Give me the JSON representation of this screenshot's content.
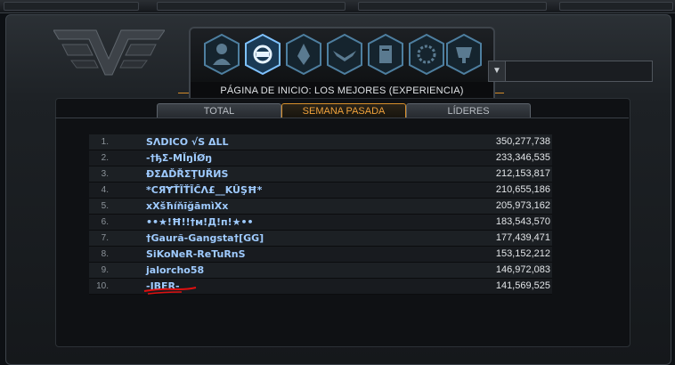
{
  "header": {
    "title": "PÁGINA DE INICIO: LOS MEJORES (EXPERIENCIA)"
  },
  "nav_icons": [
    "profile-icon",
    "emblem-icon",
    "rank-icon",
    "wings-icon",
    "codex-icon",
    "circle-icon",
    "trophy-icon"
  ],
  "tabs": [
    {
      "label": "TOTAL",
      "active": false
    },
    {
      "label": "SEMANA PASADA",
      "active": true
    },
    {
      "label": "LÍDERES",
      "active": false
    }
  ],
  "leaderboard": [
    {
      "rank": "1.",
      "name": "SΛDICO     √S     ΔLL",
      "score": "350,277,738"
    },
    {
      "rank": "2.",
      "name": "-†ђƩ-MĬŋĬØŋ",
      "score": "233,346,535"
    },
    {
      "rank": "3.",
      "name": "ĐΣΔĎŘΣŢUŘИS",
      "score": "212,153,817"
    },
    {
      "rank": "4.",
      "name": "*CЯɎŤĨŤĨĈΛ£__KÛŞĦ*",
      "score": "210,655,186"
    },
    {
      "rank": "5.",
      "name": "xXšħíňīğāmìXx",
      "score": "205,973,162"
    },
    {
      "rank": "6.",
      "name": "••★!Ħ!!†м!Д!п!★••",
      "score": "183,543,570"
    },
    {
      "rank": "7.",
      "name": "†Gaurã-Gangsta†[GG]",
      "score": "177,439,471"
    },
    {
      "rank": "8.",
      "name": "SiKoNeR-ReTuRnS",
      "score": "153,152,212"
    },
    {
      "rank": "9.",
      "name": "jalorcho58",
      "score": "146,972,083"
    },
    {
      "rank": "10.",
      "name": "-IBER-",
      "score": "141,569,525"
    }
  ],
  "colors": {
    "accent": "#f0a23c",
    "name": "#9fcbff",
    "annotation": "#e01010"
  }
}
